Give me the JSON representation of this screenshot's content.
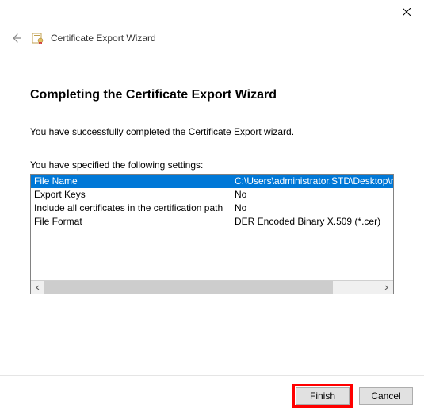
{
  "window": {
    "title": "Certificate Export Wizard"
  },
  "page": {
    "heading": "Completing the Certificate Export Wizard",
    "success": "You have successfully completed the Certificate Export wizard.",
    "settingsLabel": "You have specified the following settings:"
  },
  "settings": [
    {
      "name": "File Name",
      "value": "C:\\Users\\administrator.STD\\Desktop\\n"
    },
    {
      "name": "Export Keys",
      "value": "No"
    },
    {
      "name": "Include all certificates in the certification path",
      "value": "No"
    },
    {
      "name": "File Format",
      "value": "DER Encoded Binary X.509 (*.cer)"
    }
  ],
  "buttons": {
    "finish": "Finish",
    "cancel": "Cancel"
  }
}
